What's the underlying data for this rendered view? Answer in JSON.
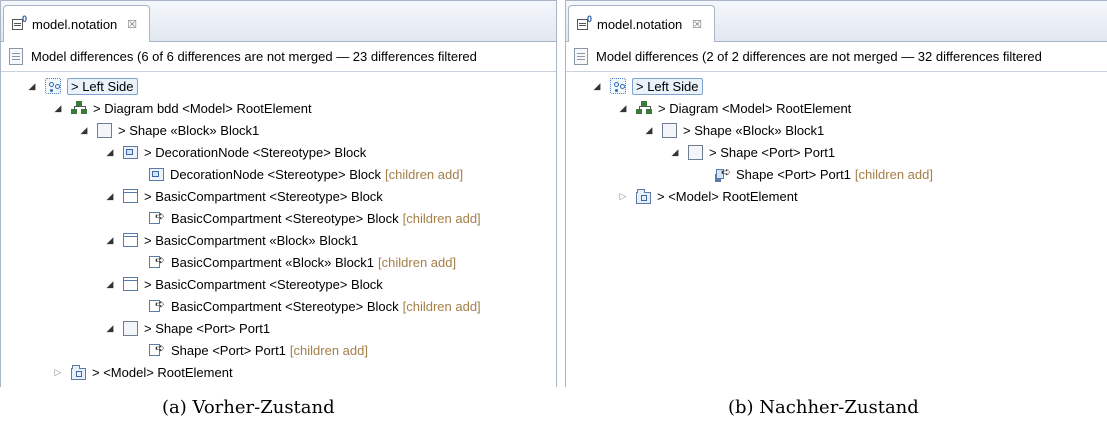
{
  "panels": [
    {
      "tab_title": "model.notation",
      "tab_close": "☒",
      "header": "Model differences  (6 of 6 differences are not merged — 23 differences filtered",
      "tree": [
        {
          "depth": 0,
          "twisty": "expanded",
          "icon": "left-side-icon",
          "label": "> Left Side",
          "tag": "",
          "selected": true
        },
        {
          "depth": 1,
          "twisty": "expanded",
          "icon": "diagram-icon",
          "label": "> Diagram bdd <Model> RootElement",
          "tag": ""
        },
        {
          "depth": 2,
          "twisty": "expanded",
          "icon": "shape-icon",
          "label": "> Shape «Block» Block1",
          "tag": ""
        },
        {
          "depth": 3,
          "twisty": "expanded",
          "icon": "decoration-node-icon",
          "label": "> DecorationNode <Stereotype> Block",
          "tag": ""
        },
        {
          "depth": 4,
          "twisty": "none",
          "icon": "add-decoration-node-icon",
          "label": "DecorationNode <Stereotype> Block",
          "tag": "[children add]"
        },
        {
          "depth": 3,
          "twisty": "expanded",
          "icon": "compartment-icon",
          "label": "> BasicCompartment <Stereotype> Block",
          "tag": ""
        },
        {
          "depth": 4,
          "twisty": "none",
          "icon": "add-compartment-icon",
          "label": "BasicCompartment <Stereotype> Block",
          "tag": "[children add]"
        },
        {
          "depth": 3,
          "twisty": "expanded",
          "icon": "compartment-icon",
          "label": "> BasicCompartment «Block» Block1",
          "tag": ""
        },
        {
          "depth": 4,
          "twisty": "none",
          "icon": "add-compartment-icon",
          "label": "BasicCompartment «Block» Block1",
          "tag": "[children add]"
        },
        {
          "depth": 3,
          "twisty": "expanded",
          "icon": "compartment-icon",
          "label": "> BasicCompartment <Stereotype> Block",
          "tag": ""
        },
        {
          "depth": 4,
          "twisty": "none",
          "icon": "add-compartment-icon",
          "label": "BasicCompartment <Stereotype> Block",
          "tag": "[children add]"
        },
        {
          "depth": 3,
          "twisty": "expanded",
          "icon": "shape-icon",
          "label": "> Shape <Port> Port1",
          "tag": ""
        },
        {
          "depth": 4,
          "twisty": "none",
          "icon": "add-shape-icon",
          "label": "Shape <Port> Port1",
          "tag": "[children add]"
        },
        {
          "depth": 1,
          "twisty": "collapsed",
          "icon": "model-icon",
          "label": "> <Model> RootElement",
          "tag": ""
        }
      ],
      "caption": "(a) Vorher-Zustand"
    },
    {
      "tab_title": "model.notation",
      "tab_close": "☒",
      "header": "Model differences  (2 of 2 differences are not merged — 32 differences filtered",
      "tree": [
        {
          "depth": 0,
          "twisty": "expanded",
          "icon": "left-side-icon",
          "label": "> Left Side",
          "tag": "",
          "selected": true
        },
        {
          "depth": 1,
          "twisty": "expanded",
          "icon": "diagram-icon",
          "label": "> Diagram <Model> RootElement",
          "tag": ""
        },
        {
          "depth": 2,
          "twisty": "expanded",
          "icon": "shape-icon",
          "label": "> Shape «Block» Block1",
          "tag": ""
        },
        {
          "depth": 3,
          "twisty": "expanded",
          "icon": "shape-icon",
          "label": "> Shape <Port> Port1",
          "tag": ""
        },
        {
          "depth": 4,
          "twisty": "none",
          "icon": "add-port-shape-icon",
          "label": "Shape <Port> Port1",
          "tag": "[children add]"
        },
        {
          "depth": 1,
          "twisty": "collapsed",
          "icon": "model-icon",
          "label": "> <Model> RootElement",
          "tag": ""
        }
      ],
      "caption": "(b) Nachher-Zustand"
    }
  ]
}
